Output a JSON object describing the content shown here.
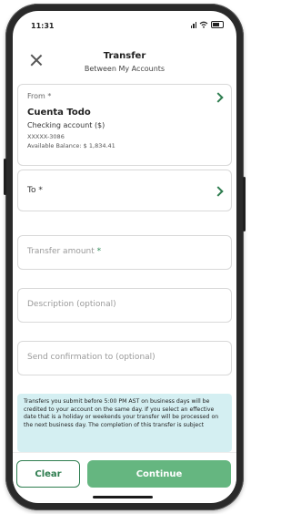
{
  "status": {
    "time": "11:31"
  },
  "header": {
    "title": "Transfer",
    "subtitle": "Between My Accounts"
  },
  "from": {
    "label": "From",
    "required_mark": "*",
    "account_name": "Cuenta Todo",
    "account_type": "Checking account ($)",
    "account_number": "XXXXX-3086",
    "available_balance": "Available Balance: $ 1,834.41"
  },
  "to": {
    "label": "To",
    "required_mark": "*"
  },
  "fields": {
    "amount_placeholder": "Transfer amount",
    "amount_required_mark": "*",
    "description_placeholder": "Description (optional)",
    "confirmation_placeholder": "Send confirmation to (optional)"
  },
  "notice": {
    "text": "Transfers you submit before 5:00 PM AST on business days will be credited to your account on the same day. If you select an effective date that is a holiday or weekends your transfer will be processed on the next business day. The completion of this transfer is subject"
  },
  "footer": {
    "clear_label": "Clear",
    "continue_label": "Continue"
  },
  "colors": {
    "accent": "#2e7d4f",
    "continue_bg": "#65b680",
    "notice_bg": "#d4eff2"
  }
}
